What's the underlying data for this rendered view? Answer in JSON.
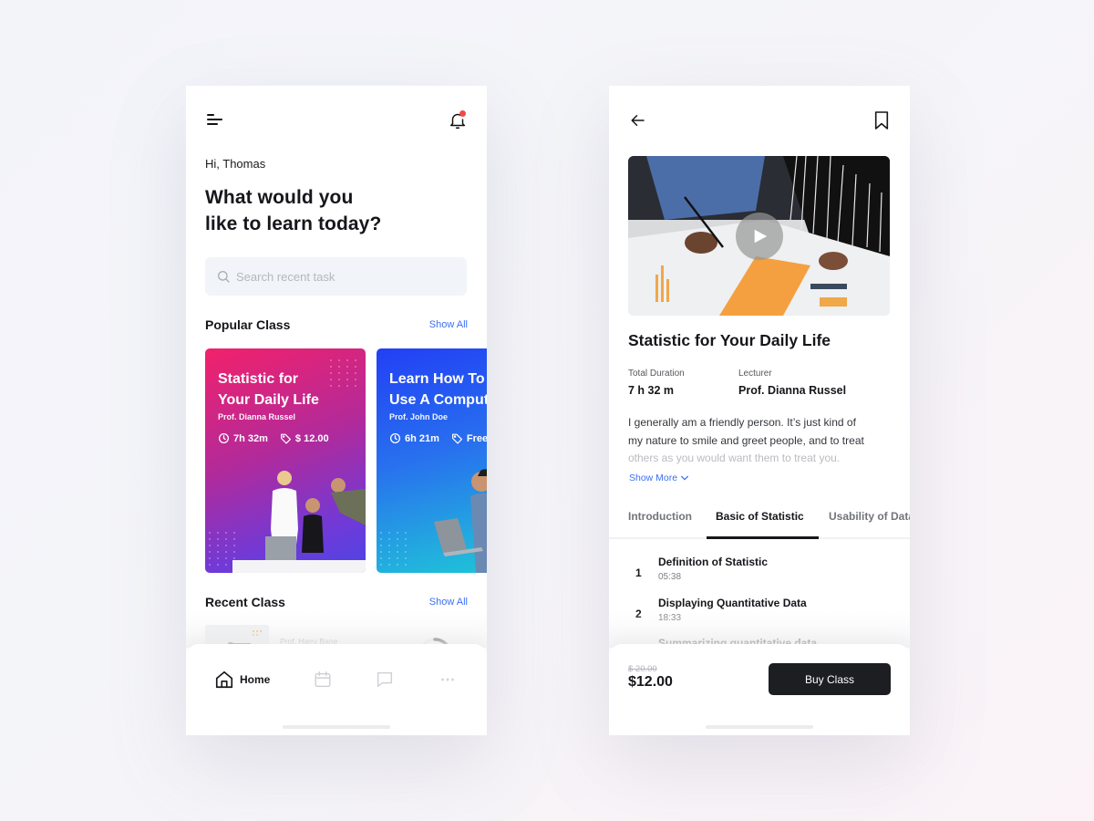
{
  "colors": {
    "accent": "#3b6ef5",
    "notification_dot": "#ef4a4a",
    "text_primary": "#16161b",
    "button_dark": "#1d1e22"
  },
  "home": {
    "header": {
      "menu_icon": "menu-icon",
      "notification_icon": "bell-icon",
      "has_notification": true
    },
    "greeting": "Hi, Thomas",
    "headline_line1": "What would you",
    "headline_line2": "like to learn today?",
    "search": {
      "placeholder": "Search recent task",
      "value": ""
    },
    "popular": {
      "title": "Popular Class",
      "show_all": "Show All",
      "cards": [
        {
          "title_line1": "Statistic for",
          "title_line2": "Your Daily Life",
          "lecturer": "Prof. Dianna Russel",
          "duration": "7h 32m",
          "price": "$ 12.00"
        },
        {
          "title_line1": "Learn How To",
          "title_line2": "Use A Computer",
          "lecturer": "Prof. John Doe",
          "duration": "6h 21m",
          "price": "Free"
        }
      ]
    },
    "recent": {
      "title": "Recent Class",
      "show_all": "Show All",
      "items": [
        {
          "lecturer": "Prof. Harry Bane"
        }
      ]
    },
    "bottom_nav": [
      {
        "label": "Home",
        "icon": "home-icon",
        "active": true
      },
      {
        "label": "",
        "icon": "calendar-icon",
        "active": false
      },
      {
        "label": "",
        "icon": "chat-icon",
        "active": false
      },
      {
        "label": "",
        "icon": "more-icon",
        "active": false
      }
    ]
  },
  "detail": {
    "header": {
      "back_icon": "arrow-left-icon",
      "bookmark_icon": "bookmark-icon"
    },
    "video": {
      "play_icon": "play-icon"
    },
    "title": "Statistic for Your Daily Life",
    "info": {
      "duration_label": "Total Duration",
      "duration_value": "7 h 32 m",
      "lecturer_label": "Lecturer",
      "lecturer_value": "Prof. Dianna Russel"
    },
    "description_line1": "I generally am a friendly person. It’s just kind of",
    "description_line2": "my nature to smile and greet people, and to treat",
    "description_line3": "others as you would want them to treat you.",
    "show_more": "Show More",
    "tabs": [
      {
        "label": "Introduction",
        "active": false
      },
      {
        "label": "Basic of Statistic",
        "active": true
      },
      {
        "label": "Usability of Data",
        "active": false
      }
    ],
    "lessons": [
      {
        "number": "1",
        "title": "Definition of Statistic",
        "duration": "05:38"
      },
      {
        "number": "2",
        "title": "Displaying Quantitative Data",
        "duration": "18:33"
      },
      {
        "number": "3",
        "title": "Summarizing quantitative data",
        "duration": ""
      }
    ],
    "purchase": {
      "old_price": "$ 20.00",
      "price": "$12.00",
      "button": "Buy Class"
    }
  }
}
